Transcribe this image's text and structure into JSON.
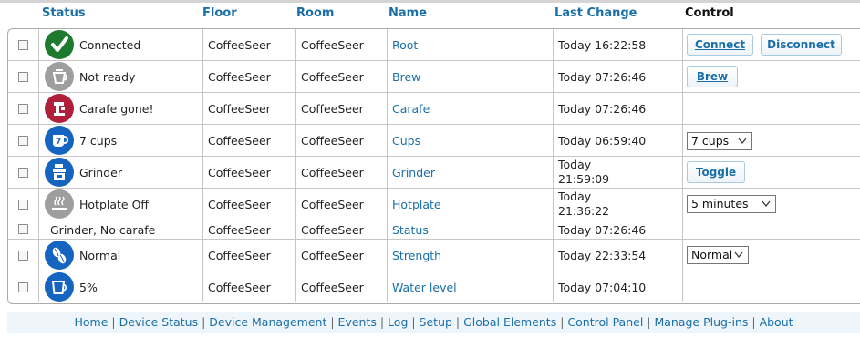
{
  "columns": {
    "status": "Status",
    "floor": "Floor",
    "room": "Room",
    "name": "Name",
    "last_change": "Last Change",
    "control": "Control"
  },
  "rows": [
    {
      "status": "Connected",
      "icon": "check-icon",
      "icon_color": "#1e7a2e",
      "floor": "CoffeeSeer",
      "room": "CoffeeSeer",
      "name": "Root",
      "last_change": "Today 16:22:58",
      "controls": {
        "buttons": [
          "Connect",
          "Disconnect"
        ]
      }
    },
    {
      "status": "Not ready",
      "icon": "coffee-pot-icon",
      "icon_color": "#9e9e9e",
      "floor": "CoffeeSeer",
      "room": "CoffeeSeer",
      "name": "Brew",
      "last_change": "Today 07:26:46",
      "controls": {
        "buttons": [
          "Brew"
        ]
      }
    },
    {
      "status": "Carafe gone!",
      "icon": "carafe-icon",
      "icon_color": "#b0203a",
      "floor": "CoffeeSeer",
      "room": "CoffeeSeer",
      "name": "Carafe",
      "last_change": "Today 07:26:46",
      "controls": {}
    },
    {
      "status": "7 cups",
      "icon": "cups-icon",
      "icon_color": "#1565c0",
      "floor": "CoffeeSeer",
      "room": "CoffeeSeer",
      "name": "Cups",
      "last_change": "Today 06:59:40",
      "controls": {
        "select": "7 cups"
      }
    },
    {
      "status": "Grinder",
      "icon": "grinder-icon",
      "icon_color": "#1565c0",
      "floor": "CoffeeSeer",
      "room": "CoffeeSeer",
      "name": "Grinder",
      "last_change_line1": "Today",
      "last_change_line2": "21:59:09",
      "controls": {
        "buttons": [
          "Toggle"
        ]
      }
    },
    {
      "status": "Hotplate Off",
      "icon": "hotplate-icon",
      "icon_color": "#9e9e9e",
      "floor": "CoffeeSeer",
      "room": "CoffeeSeer",
      "name": "Hotplate",
      "last_change_line1": "Today",
      "last_change_line2": "21:36:22",
      "controls": {
        "select": "5 minutes"
      }
    },
    {
      "status": "Grinder, No carafe",
      "floor": "CoffeeSeer",
      "room": "CoffeeSeer",
      "name": "Status",
      "last_change": "Today 07:26:46",
      "controls": {}
    },
    {
      "status": "Normal",
      "icon": "coffee-beans-icon",
      "icon_color": "#1565c0",
      "floor": "CoffeeSeer",
      "room": "CoffeeSeer",
      "name": "Strength",
      "last_change": "Today 22:33:54",
      "controls": {
        "select": "Normal"
      }
    },
    {
      "status": "5%",
      "icon": "water-cup-icon",
      "icon_color": "#1565c0",
      "floor": "CoffeeSeer",
      "room": "CoffeeSeer",
      "name": "Water level",
      "last_change": "Today 07:04:10",
      "controls": {}
    }
  ],
  "footer": {
    "links": [
      "Home",
      "Device Status",
      "Device Management",
      "Events",
      "Log",
      "Setup",
      "Global Elements",
      "Control Panel",
      "Manage Plug-ins",
      "About"
    ],
    "separator": " | "
  },
  "colors": {
    "link": "#1a6fa8",
    "footer_bg": "#eef5fb"
  }
}
